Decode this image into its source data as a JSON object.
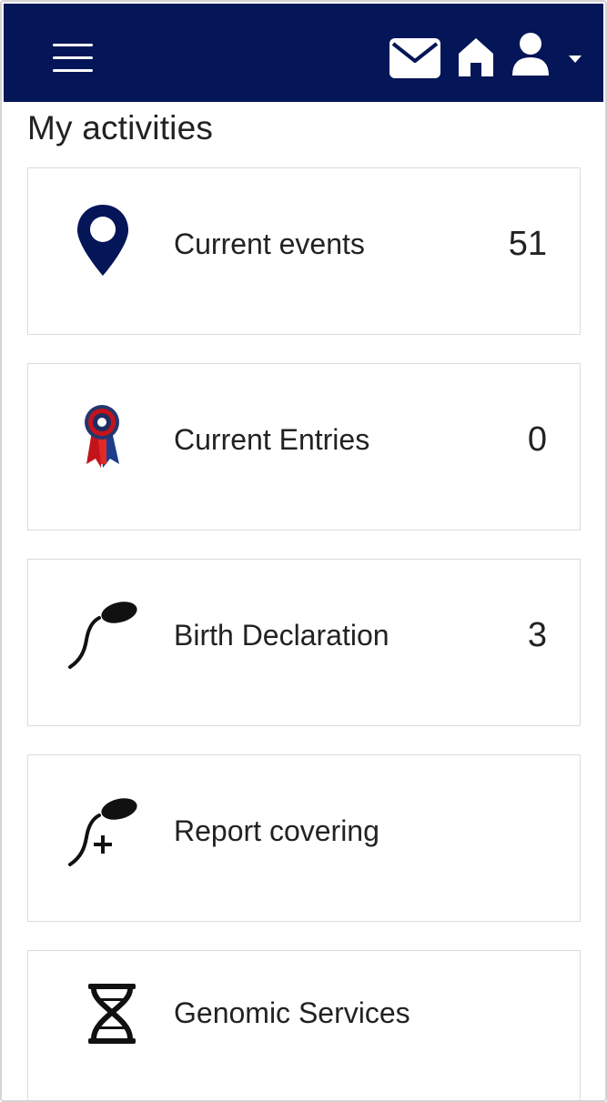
{
  "header": {
    "background_color": "#041657",
    "icons": [
      "hamburger-menu-icon",
      "envelope-icon",
      "home-icon",
      "user-icon",
      "caret-down-icon"
    ]
  },
  "page": {
    "title": "My activities"
  },
  "activities": [
    {
      "label": "Current events",
      "count": "51",
      "icon": "map-pin-icon"
    },
    {
      "label": "Current Entries",
      "count": "0",
      "icon": "rosette-ribbon-icon"
    },
    {
      "label": "Birth Declaration",
      "count": "3",
      "icon": "sperm-icon"
    },
    {
      "label": "Report covering",
      "count": "",
      "icon": "sperm-plus-icon"
    },
    {
      "label": "Genomic Services",
      "count": "",
      "icon": "dna-icon"
    }
  ]
}
